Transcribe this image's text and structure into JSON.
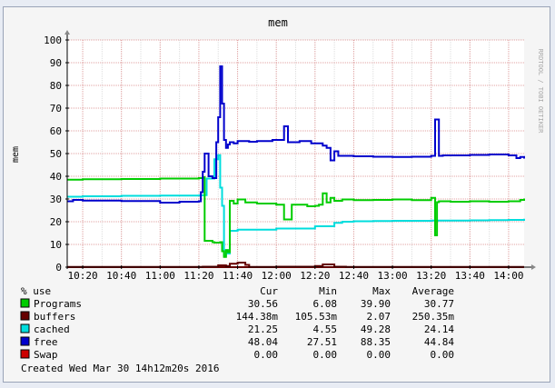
{
  "chart_data": {
    "type": "line",
    "title": "mem",
    "ylabel": "mem",
    "watermark": "RRDTOOL / TOBI OETIKER",
    "ylim": [
      0,
      100
    ],
    "yticks": [
      0,
      10,
      20,
      30,
      40,
      50,
      60,
      70,
      80,
      90,
      100
    ],
    "xticks": [
      "10:20",
      "10:40",
      "11:00",
      "11:20",
      "11:40",
      "12:00",
      "12:20",
      "12:40",
      "13:00",
      "13:20",
      "13:40",
      "14:00"
    ],
    "grid": true,
    "colors": {
      "background": "#f5f5f5",
      "canvas": "#ffffff",
      "grid_minor": "#dddddd",
      "grid_major": "#e0a0a0",
      "axis": "#000000"
    },
    "series": [
      {
        "name": "Programs",
        "color": "#00cc00",
        "x": [
          "10:12",
          "10:20",
          "10:40",
          "11:00",
          "11:20",
          "11:22",
          "11:23",
          "11:27",
          "11:28",
          "11:31",
          "11:32",
          "11:33",
          "11:34",
          "11:35",
          "11:36",
          "11:38",
          "11:40",
          "11:44",
          "11:50",
          "12:00",
          "12:04",
          "12:08",
          "12:12",
          "12:16",
          "12:20",
          "12:22",
          "12:24",
          "12:26",
          "12:28",
          "12:30",
          "12:34",
          "12:40",
          "12:50",
          "13:00",
          "13:10",
          "13:20",
          "13:22",
          "13:23",
          "13:24",
          "13:30",
          "13:40",
          "13:50",
          "14:00",
          "14:06",
          "14:08"
        ],
        "values": [
          38.5,
          38.7,
          38.8,
          39.0,
          39.2,
          39.6,
          11.6,
          11.0,
          10.8,
          11.0,
          7.0,
          4.5,
          7.5,
          6.6,
          29.2,
          28.0,
          29.8,
          28.5,
          28.0,
          27.5,
          21.0,
          27.5,
          27.5,
          26.8,
          27.0,
          27.5,
          32.5,
          28.5,
          30.5,
          29.2,
          29.8,
          29.5,
          29.6,
          29.8,
          29.5,
          30.5,
          14.0,
          28.6,
          29.0,
          28.8,
          29.0,
          28.8,
          29.0,
          29.6,
          30.2
        ]
      },
      {
        "name": "buffers",
        "color": "#660000",
        "x": [
          "10:12",
          "11:20",
          "11:22",
          "11:30",
          "11:34",
          "11:36",
          "11:40",
          "11:44",
          "11:46",
          "12:00",
          "12:20",
          "12:24",
          "12:30",
          "12:36",
          "14:08"
        ],
        "values": [
          0.1,
          0.1,
          0.2,
          0.8,
          0.5,
          1.5,
          2.0,
          1.0,
          0.1,
          0.2,
          0.5,
          1.2,
          0.2,
          0.1,
          0.1
        ]
      },
      {
        "name": "cached",
        "color": "#00dddd",
        "x": [
          "10:12",
          "10:20",
          "10:40",
          "11:00",
          "11:20",
          "11:22",
          "11:24",
          "11:28",
          "11:30",
          "11:31",
          "11:32",
          "11:33",
          "11:34",
          "11:35",
          "11:36",
          "11:40",
          "11:50",
          "12:00",
          "12:10",
          "12:20",
          "12:30",
          "12:34",
          "12:40",
          "12:50",
          "13:00",
          "13:10",
          "13:20",
          "13:30",
          "13:40",
          "13:50",
          "14:00",
          "14:08"
        ],
        "values": [
          31.0,
          31.2,
          31.4,
          31.5,
          31.6,
          31.7,
          39.0,
          47.5,
          49.3,
          35.0,
          27.0,
          5.0,
          7.5,
          6.0,
          16.0,
          16.5,
          16.5,
          17.0,
          17.0,
          18.0,
          19.5,
          20.0,
          20.2,
          20.3,
          20.4,
          20.4,
          20.5,
          20.5,
          20.6,
          20.7,
          20.8,
          21.3
        ]
      },
      {
        "name": "free",
        "color": "#0000cc",
        "x": [
          "10:12",
          "10:15",
          "10:20",
          "10:40",
          "11:00",
          "11:10",
          "11:20",
          "11:21",
          "11:22",
          "11:23",
          "11:25",
          "11:27",
          "11:29",
          "11:30",
          "11:31",
          "11:32",
          "11:33",
          "11:34",
          "11:35",
          "11:36",
          "11:38",
          "11:40",
          "11:46",
          "11:50",
          "11:58",
          "12:04",
          "12:06",
          "12:08",
          "12:12",
          "12:18",
          "12:24",
          "12:26",
          "12:28",
          "12:30",
          "12:32",
          "12:40",
          "12:50",
          "13:00",
          "13:10",
          "13:20",
          "13:22",
          "13:24",
          "13:26",
          "13:40",
          "13:50",
          "14:00",
          "14:04",
          "14:06",
          "14:08"
        ],
        "values": [
          29.0,
          29.6,
          29.3,
          29.1,
          28.4,
          28.8,
          29.0,
          33.0,
          42.0,
          50.0,
          40.0,
          39.2,
          55.0,
          66.0,
          88.4,
          72.0,
          56.0,
          52.5,
          54.0,
          55.0,
          54.5,
          55.5,
          55.2,
          55.5,
          56.0,
          62.0,
          55.0,
          55.0,
          55.5,
          54.5,
          53.5,
          52.5,
          47.0,
          51.0,
          49.0,
          48.8,
          48.6,
          48.5,
          48.6,
          49.0,
          65.0,
          49.0,
          49.2,
          49.4,
          49.6,
          49.2,
          48.0,
          48.5,
          47.8
        ]
      },
      {
        "name": "Swap",
        "color": "#cc0000",
        "x": [
          "10:12",
          "14:08"
        ],
        "values": [
          0.0,
          0.0
        ]
      }
    ],
    "legend": {
      "header": [
        "% use",
        "Cur",
        "Min",
        "Max",
        "Average"
      ],
      "rows": [
        {
          "name": "Programs",
          "color": "#00cc00",
          "cur": "30.56",
          "min": "6.08",
          "max": "39.90",
          "avg": "30.77"
        },
        {
          "name": "buffers",
          "color": "#660000",
          "cur": "144.38m",
          "min": "105.53m",
          "max": "2.07",
          "avg": "250.35m"
        },
        {
          "name": "cached",
          "color": "#00dddd",
          "cur": "21.25",
          "min": "4.55",
          "max": "49.28",
          "avg": "24.14"
        },
        {
          "name": "free",
          "color": "#0000cc",
          "cur": "48.04",
          "min": "27.51",
          "max": "88.35",
          "avg": "44.84"
        },
        {
          "name": "Swap",
          "color": "#cc0000",
          "cur": "0.00",
          "min": "0.00",
          "max": "0.00",
          "avg": "0.00"
        }
      ],
      "footer": "Created Wed Mar 30 14h12m20s 2016"
    }
  }
}
